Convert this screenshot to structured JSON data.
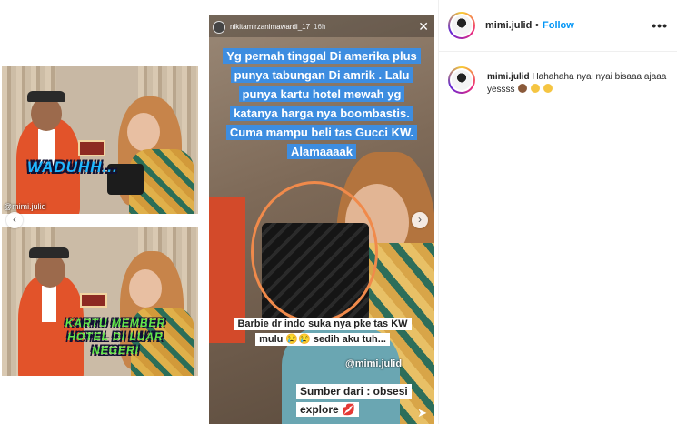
{
  "post": {
    "username": "mimi.julid",
    "separator": "•",
    "follow_label": "Follow",
    "more_icon": "more-horizontal-icon",
    "caption_text": "Hahahaha nyai nyai bisaaa ajaaa yessss",
    "caption_emojis": [
      "monkey-face-icon",
      "laughing-face-icon",
      "smiling-face-icon"
    ]
  },
  "panels": {
    "top_caption": "WADUHH...",
    "bottom_caption_line1": "KARTU MEMBER",
    "bottom_caption_line2": "HOTEL DI LUAR NEGERI",
    "watermark": "@mimi.julid"
  },
  "story": {
    "username": "nikitamirzanimawardi_17",
    "time": "16h",
    "text_lines": [
      "Yg pernah tinggal Di amerika plus",
      "punya tabungan Di amrik . Lalu",
      "punya kartu hotel mewah yg",
      "katanya harga nya boombastis.",
      "Cuma mampu beli tas Gucci KW.",
      "Alamaaaak"
    ],
    "caption2_line1": "Barbie dr indo suka nya pke tas KW",
    "caption2_line2": "mulu 😢😢 sedih aku tuh...",
    "watermark": "@mimi.julid",
    "source_line1": "Sumber dari : obsesi",
    "source_line2": "explore 💋"
  },
  "colors": {
    "follow": "#0095f6",
    "story_highlight": "#3d8de0",
    "circle": "#f08a4b"
  }
}
